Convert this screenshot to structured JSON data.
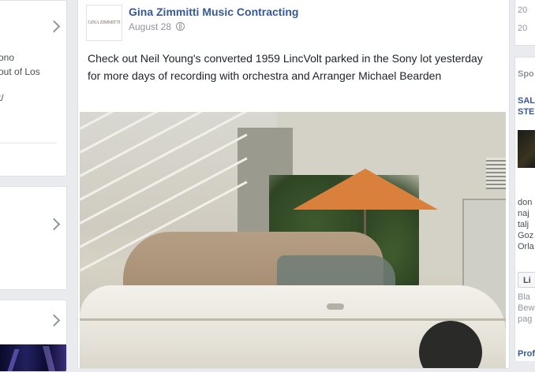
{
  "left_column": {
    "card1": {
      "snippets": [
        "ono",
        "out of Los",
        "t/"
      ]
    }
  },
  "post": {
    "author": "Gina Zimmitti Music Contracting",
    "avatar_text": "GINA ZIMMITTI",
    "date": "August 28",
    "text": "Check out Neil Young's converted 1959 LincVolt parked in the Sony lot yesterday for more days of recording with orchestra and Arranger Michael Bearden",
    "photo_icon": "photo-car"
  },
  "right_column": {
    "years": [
      "20",
      "20"
    ],
    "sponsored_label": "Spo",
    "ad_title_lines": [
      "SAL",
      "STE"
    ],
    "ad_text_lines": [
      "don",
      "naj",
      "talj",
      "Goz",
      "Orla"
    ],
    "like_label": "Li",
    "meta_lines": [
      "Bla",
      "Bew",
      "pag"
    ],
    "bottom_label": "Prof"
  },
  "colors": {
    "link": "#365899",
    "background": "#e9ebee",
    "card": "#ffffff"
  }
}
